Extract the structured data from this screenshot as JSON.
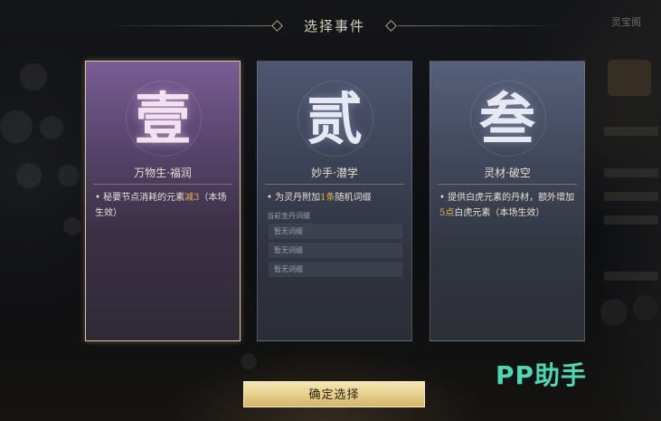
{
  "title": "选择事件",
  "side_panel": {
    "label": "灵宝阁"
  },
  "cards": [
    {
      "numeral": "壹",
      "title": "万物生·福润",
      "bullet": "• ",
      "desc_before": "秘要节点消耗的元素",
      "desc_highlight": "减3",
      "desc_after": "（本场生效）"
    },
    {
      "numeral": "贰",
      "title": "妙手·潜学",
      "bullet": "• ",
      "desc_before": "为灵丹附加",
      "desc_highlight": "1条",
      "desc_after": "随机词缀",
      "affix_label": "当前金丹词缀",
      "affix_slots": [
        "暂无词缀",
        "暂无词缀",
        "暂无词缀"
      ]
    },
    {
      "numeral": "叁",
      "title": "灵材·破空",
      "bullet": "• ",
      "desc_before": "提供白虎元素的丹材，额外增加",
      "desc_highlight": "5点",
      "desc_after": "白虎元素（本场生效）"
    }
  ],
  "confirm_label": "确定选择",
  "watermark": "PP助手",
  "colors": {
    "highlight": "#e6b45a",
    "selected_border": "#d9c59a",
    "button_gold": "#e5cc8a",
    "watermark": "#4fd6b3"
  }
}
